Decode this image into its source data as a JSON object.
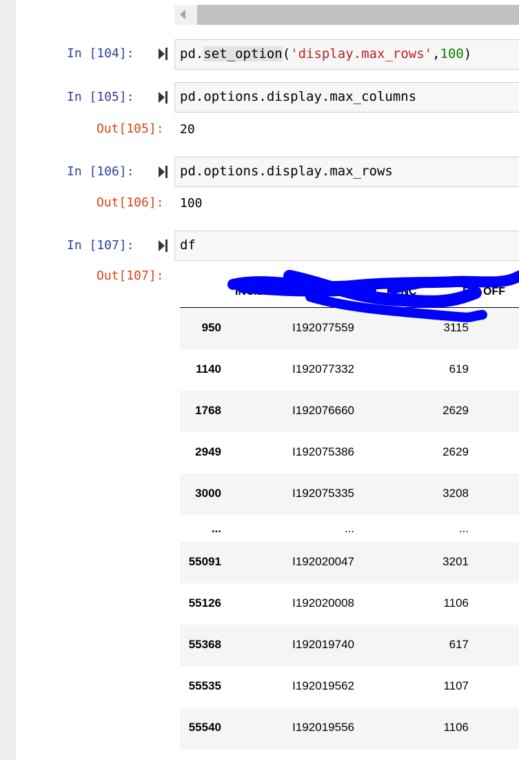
{
  "cells": [
    {
      "in_prompt": "In [104]:",
      "code_parts": [
        "pd.",
        "set_option",
        "(",
        "'display.max_rows'",
        ",",
        "100",
        ")"
      ]
    },
    {
      "in_prompt": "In [105]:",
      "code": "pd.options.display.max_columns",
      "out_prompt": "Out[105]:",
      "output": "20"
    },
    {
      "in_prompt": "In [106]:",
      "code": "pd.options.display.max_rows",
      "out_prompt": "Out[106]:",
      "output": "100"
    },
    {
      "in_prompt": "In [107]:",
      "code": "df",
      "out_prompt": "Out[107]:"
    }
  ],
  "dataframe": {
    "headers_visible": [
      "INCIDE",
      "FENC",
      "E",
      "OFF"
    ],
    "rows": [
      {
        "index": "950",
        "c1": "I192077559",
        "c2": "3115"
      },
      {
        "index": "1140",
        "c1": "I192077332",
        "c2": "619"
      },
      {
        "index": "1768",
        "c1": "I192076660",
        "c2": "2629"
      },
      {
        "index": "2949",
        "c1": "I192075386",
        "c2": "2629"
      },
      {
        "index": "3000",
        "c1": "I192075335",
        "c2": "3208"
      },
      {
        "index": "...",
        "c1": "...",
        "c2": "..."
      },
      {
        "index": "55091",
        "c1": "I192020047",
        "c2": "3201"
      },
      {
        "index": "55126",
        "c1": "I192020008",
        "c2": "1106"
      },
      {
        "index": "55368",
        "c1": "I192019740",
        "c2": "617"
      },
      {
        "index": "55535",
        "c1": "I192019562",
        "c2": "1107"
      },
      {
        "index": "55540",
        "c1": "I192019556",
        "c2": "1106"
      }
    ]
  },
  "colors": {
    "in_prompt": "#303f9f",
    "out_prompt": "#d84315",
    "string": "#ba2121",
    "number": "#008000",
    "redaction": "#0000ff"
  },
  "icons": {
    "run": "run-cell-icon",
    "scroll_left": "chevron-left-icon"
  }
}
